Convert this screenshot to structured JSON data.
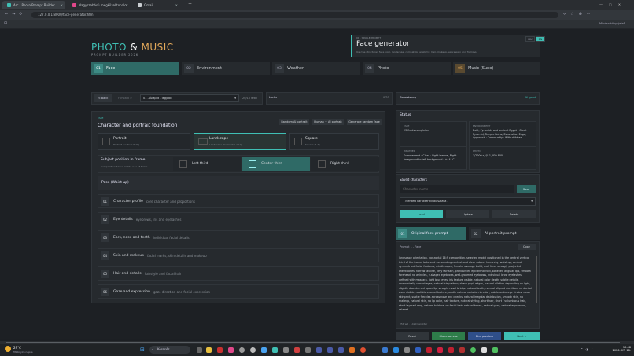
{
  "browser": {
    "tabs": [
      {
        "label": "Arc - Photo Prompt Builder",
        "active": true
      },
      {
        "label": "Nagyszabású megközelítopalo…",
        "active": false
      },
      {
        "label": "Gmail",
        "active": false
      }
    ],
    "url": "127.0.0.1:8000/face-generator.html",
    "bookmark_right": "Minden könyvjelző"
  },
  "brand": {
    "photo": "PHOTO",
    "amp": "&",
    "music": "MUSIC",
    "sub": "PROMPT BUILDER 2026"
  },
  "header": {
    "kicker": "01 · SINGLE PROMPT",
    "title": "Face generator",
    "sub": "Use the structured face logic, landscape, compatible anatomy, hair, makeup, expression and framing.",
    "lang_hu": "HU",
    "lang_en": "EN"
  },
  "steps": [
    {
      "n": "01",
      "label": "Face"
    },
    {
      "n": "02",
      "label": "Environment"
    },
    {
      "n": "03",
      "label": "Weather"
    },
    {
      "n": "04",
      "label": "Photo"
    },
    {
      "n": "05",
      "label": "Music (Suno)"
    }
  ],
  "toolbar": {
    "back": "< Back",
    "forward": "Forward >",
    "select_value": "01 - Állapot - legjobb",
    "select_meta": "20/10 tétel",
    "locks": "Locks",
    "locks_count": "0/33"
  },
  "face": {
    "kicker": "FACE",
    "title": "Character and portrait foundation",
    "btn_random_all": "Random AI portrait",
    "btn_human": "Human + AI portrait",
    "btn_generate": "Generate random face"
  },
  "options": [
    {
      "label": "Portrait",
      "desc": "Portrait (vertical 9:16)"
    },
    {
      "label": "Landscape",
      "desc": "Landscape (horizontal 16:9)"
    },
    {
      "label": "Square",
      "desc": "Square (1:1)"
    }
  ],
  "subject": {
    "title": "Subject position in frame",
    "desc": "Composition based on the rule of thirds",
    "left": "Left third",
    "center": "Center third",
    "right": "Right third"
  },
  "pose": "Pose (Waist up)",
  "sections": [
    {
      "n": "01",
      "label": "Character profile",
      "sub": "core character and proportions"
    },
    {
      "n": "02",
      "label": "Eye details",
      "sub": "eyebrows, iris and eyelashes"
    },
    {
      "n": "03",
      "label": "Ears, nose and teeth",
      "sub": "individual facial details"
    },
    {
      "n": "04",
      "label": "Skin and makeup",
      "sub": "facial marks, skin details and makeup"
    },
    {
      "n": "05",
      "label": "Hair and details",
      "sub": "hairstyle and facial hair"
    },
    {
      "n": "06",
      "label": "Gaze and expression",
      "sub": "gaze direction and facial expression"
    }
  ],
  "consistency": {
    "title": "Consistency",
    "badge": "All good"
  },
  "status": {
    "title": "Status",
    "items": [
      {
        "k": "FACE",
        "v": "23 fields completed"
      },
      {
        "k": "ENVIRONMENT",
        "v": "Built, Pyramids and ancient Egypt - Great Pyramid, Temple Ruins, Excavation Edge, Approach · Community · With children"
      },
      {
        "k": "WEATHER",
        "v": "Summer mid · Clear · Light breeze, Right foreground to left background · +44 °C"
      },
      {
        "k": "PHOTO",
        "v": "1/2000 s, f/11, ISO 800"
      }
    ]
  },
  "saved": {
    "title": "Saved characters",
    "placeholder": "Character name",
    "save": "Save",
    "select": "- Mentett karakter kiválasztása -",
    "load": "Load",
    "update": "Update",
    "delete": "Delete"
  },
  "prompt_tabs": [
    {
      "n": "01",
      "label": "Original face prompt"
    },
    {
      "n": "02",
      "label": "AI portrait prompt"
    }
  ],
  "prompt": {
    "label": "Prompt 1 - Face",
    "copy": "Copy",
    "text": "landscape orientation, horizontal 16:9 composition, selected model positioned in the central vertical third of the frame, balanced surrounding context and clear subject hierarchy, waist up, central symmetrical facial features, middle-aged, female, average build, oval face, strongly projected cheekbones, narrow jawline, very fair skin, pronounced epicanthic fold, softened angular lips, smooth forehead, no wrinkles, v-shaped eyebrows, well-groomed eyebrows, individual brow eyelashes, defined with mascara, light blue eyes, iris texture visible, natural color depth, subtle details, anatomically correct eyes, natural iris pattern, sharp pupil edges, natural dilation depending on light, slightly downturned upper lip, straight nasal bridge, natural teeth, normal aligned dentition, no dental work visible, realistic enamel texture, subtle natural variation in color, subtle under-eye circles, clean skinprint, subtle freckles across nose and cheeks, natural irregular distribution, smooth skin, no makeup, natural skin, no lip color, hair texture, natural styling, short hair, short / voluminous hair, short layered crop, natural hairline, no facial hair, natural brows, natural gaze, natural expression, relaxed",
    "count": "256 wd · 1420 karakter"
  },
  "footer": {
    "reset": "Reset",
    "share": "Share access",
    "preview": "Blur preview",
    "next": "Next >"
  },
  "taskbar": {
    "weather": "29°C",
    "weather_sub": "Többnyire napos",
    "search": "Keresés",
    "time": "10:48",
    "date": "2026. 07. 18."
  }
}
